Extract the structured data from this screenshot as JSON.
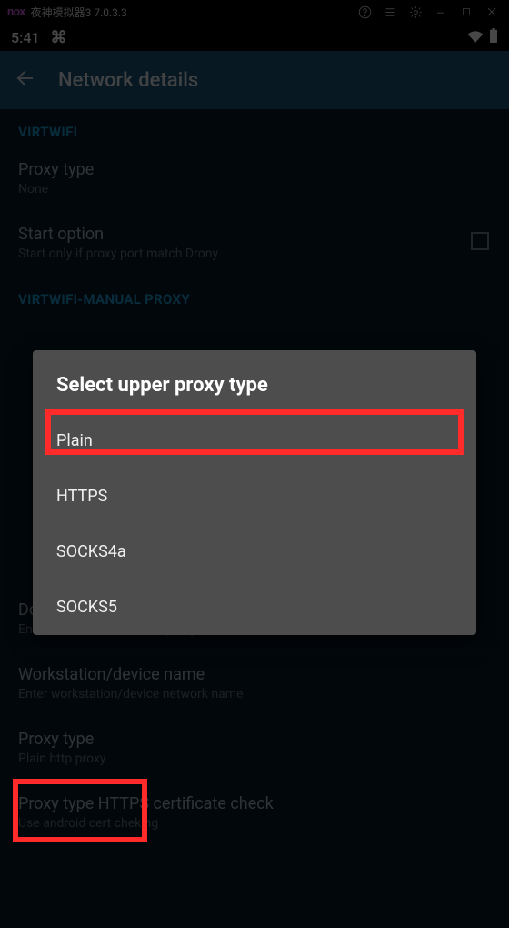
{
  "nox": {
    "logo": "nox",
    "title": "夜神模拟器3 7.0.3.3"
  },
  "status": {
    "time": "5:41"
  },
  "header": {
    "title": "Network details"
  },
  "sections": {
    "virtwifi": "VIRTWIFI",
    "virtwifi_manual": "VIRTWIFI-MANUAL PROXY"
  },
  "items": {
    "proxy_type1": {
      "primary": "Proxy type",
      "secondary": "None"
    },
    "start_option": {
      "primary": "Start option",
      "secondary": "Start only if proxy port match Drony"
    },
    "domain": {
      "primary": "Domain or Realm",
      "secondary": "Enter domain or realm for proxy"
    },
    "workstation": {
      "primary": "Workstation/device name",
      "secondary": "Enter workstation/device network name"
    },
    "proxy_type2": {
      "primary": "Proxy type",
      "secondary": "Plain http proxy"
    },
    "cert_check": {
      "primary": "Proxy type HTTPS certificate check",
      "secondary": "Use android cert cheking"
    }
  },
  "dialog": {
    "title": "Select upper proxy type",
    "options": {
      "plain": "Plain",
      "https": "HTTPS",
      "socks4a": "SOCKS4a",
      "socks5": "SOCKS5"
    }
  }
}
